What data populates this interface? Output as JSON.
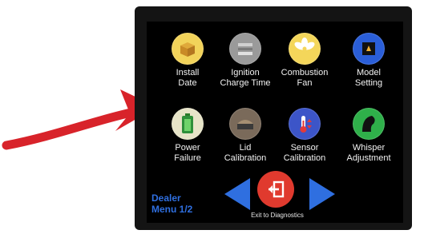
{
  "tiles": [
    {
      "label_1": "Install",
      "label_2": "Date",
      "icon": "box-icon",
      "color": "#f2d35a"
    },
    {
      "label_1": "Ignition",
      "label_2": "Charge Time",
      "icon": "igniter-icon",
      "color": "#9a9a9a"
    },
    {
      "label_1": "Combustion",
      "label_2": "Fan",
      "icon": "fan-icon",
      "color": "#f4d65a"
    },
    {
      "label_1": "Model",
      "label_2": "Setting",
      "icon": "grill-icon",
      "color": "#2a5ed8"
    },
    {
      "label_1": "Power",
      "label_2": "Failure",
      "icon": "battery-icon",
      "color": "#e7e4c8"
    },
    {
      "label_1": "Lid",
      "label_2": "Calibration",
      "icon": "lid-icon",
      "color": "#7a6a5a"
    },
    {
      "label_1": "Sensor",
      "label_2": "Calibration",
      "icon": "thermometer-icon",
      "color": "#3c55c8"
    },
    {
      "label_1": "Whisper",
      "label_2": "Adjustment",
      "icon": "whisper-icon",
      "color": "#2fb04a"
    }
  ],
  "footer": {
    "dealer_1": "Dealer",
    "dealer_2": "Menu 1/2",
    "exit_label": "Exit to Diagnostics"
  },
  "colors": {
    "arrow": "#d8232a",
    "nav_arrow": "#2f6fe0",
    "exit_button": "#e03a2e",
    "dealer_text": "#2f6fe0"
  }
}
